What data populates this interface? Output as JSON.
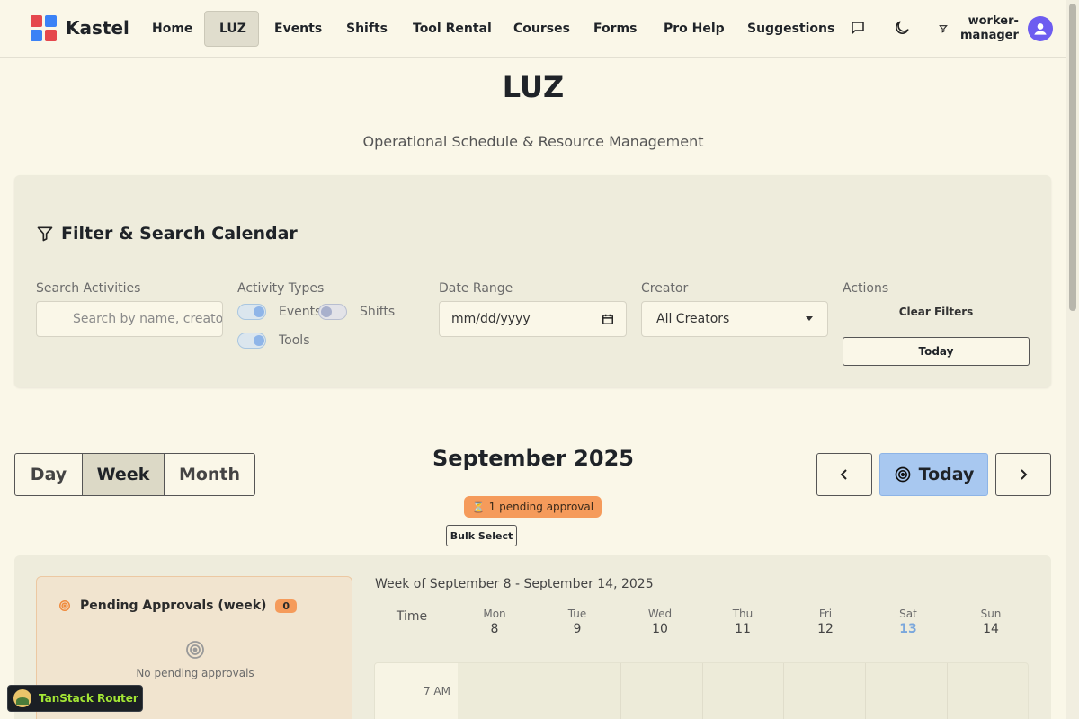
{
  "app": {
    "brand": "Kastel"
  },
  "nav": {
    "items": [
      {
        "label": "Home",
        "active": false
      },
      {
        "label": "LUZ",
        "active": true
      },
      {
        "label": "Events",
        "active": false
      },
      {
        "label": "Shifts",
        "active": false
      },
      {
        "label": "Tool Rental",
        "active": false
      },
      {
        "label": "Courses",
        "active": false
      },
      {
        "label": "Forms",
        "active": false
      },
      {
        "label": "Pro Help",
        "active": false
      },
      {
        "label": "Suggestions",
        "active": false
      }
    ],
    "user_line1": "worker-",
    "user_line2": "manager"
  },
  "page": {
    "title": "LUZ",
    "subtitle": "Operational Schedule & Resource Management"
  },
  "filters": {
    "title": "Filter & Search Calendar",
    "search_label": "Search Activities",
    "search_placeholder": "Search by name, creator...",
    "types_label": "Activity Types",
    "toggles": [
      {
        "label": "Events",
        "on": true
      },
      {
        "label": "Shifts",
        "on": false
      },
      {
        "label": "Tools",
        "on": true
      }
    ],
    "date_label": "Date Range",
    "date_placeholder": "mm/dd/yyyy",
    "creator_label": "Creator",
    "creator_value": "All Creators",
    "actions_label": "Actions",
    "clear_label": "Clear Filters",
    "today_label": "Today"
  },
  "calendar": {
    "views": [
      {
        "label": "Day",
        "active": false
      },
      {
        "label": "Week",
        "active": true
      },
      {
        "label": "Month",
        "active": false
      }
    ],
    "month_title": "September 2025",
    "pending_pill": "⏳ 1 pending approval",
    "bulk_select": "Bulk Select",
    "today_button": "Today",
    "week_label": "Week of September 8 - September 14, 2025",
    "time_header": "Time",
    "days": [
      {
        "name": "Mon",
        "date": "8",
        "today": false
      },
      {
        "name": "Tue",
        "date": "9",
        "today": false
      },
      {
        "name": "Wed",
        "date": "10",
        "today": false
      },
      {
        "name": "Thu",
        "date": "11",
        "today": false
      },
      {
        "name": "Fri",
        "date": "12",
        "today": false
      },
      {
        "name": "Sat",
        "date": "13",
        "today": true
      },
      {
        "name": "Sun",
        "date": "14",
        "today": false
      }
    ],
    "first_slot": "7 AM"
  },
  "pending": {
    "title": "Pending Approvals (week)",
    "count": "0",
    "empty": "No pending approvals"
  },
  "devtools": {
    "label": "TanStack Router"
  },
  "colors": {
    "background": "#faf7e8",
    "accent": "#a8c8f0",
    "pending": "#f59b5b",
    "today": "#7aa7dc"
  }
}
